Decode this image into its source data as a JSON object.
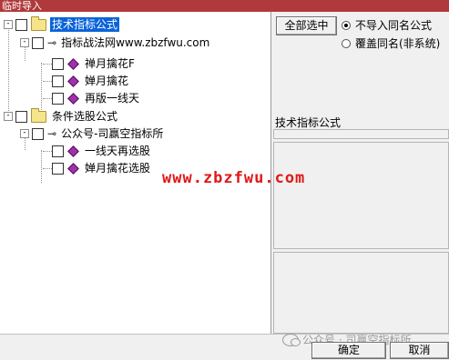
{
  "window": {
    "title": "临时导入"
  },
  "tree": {
    "groups": [
      {
        "label": "技术指标公式",
        "expander": "-",
        "selected": true,
        "children": [
          {
            "label": "指标战法网www.zbzfwu.com",
            "expander": "-",
            "items": [
              "禅月擒花F",
              "婵月擒花",
              "再版一线天"
            ]
          }
        ]
      },
      {
        "label": "条件选股公式",
        "expander": "-",
        "selected": false,
        "children": [
          {
            "label": "公众号-司赢空指标所",
            "expander": "-",
            "items": [
              "一线天再选股",
              "婵月擒花选股"
            ]
          }
        ]
      }
    ]
  },
  "controls": {
    "select_all_label": "全部选中",
    "radio_options": [
      {
        "label": "不导入同名公式",
        "checked": true
      },
      {
        "label": "覆盖同名(非系统)",
        "checked": false
      }
    ]
  },
  "detail": {
    "title": "技术指标公式"
  },
  "watermark": {
    "text": "www.zbzfwu.com",
    "color": "#e01818"
  },
  "footer": {
    "wechat_text": "公众号 · 司赢空指标所",
    "ok_label": "确定",
    "cancel_label": "取消"
  }
}
